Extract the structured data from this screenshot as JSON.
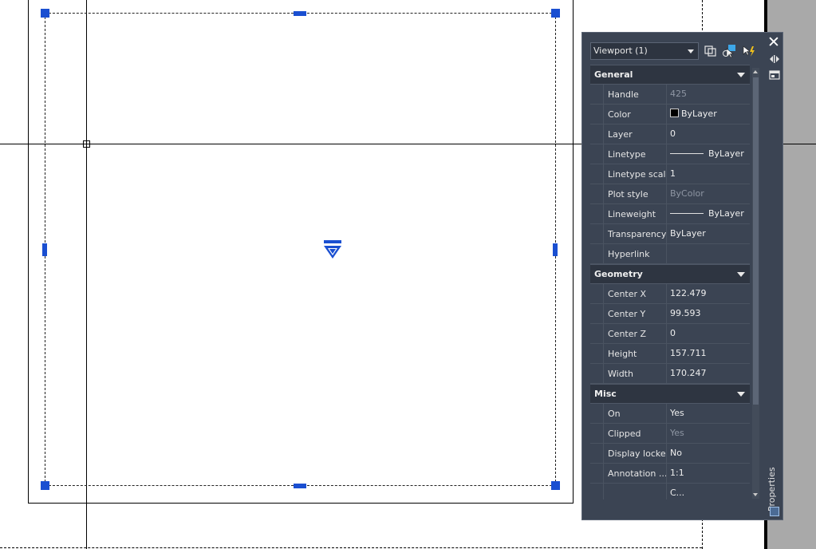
{
  "palette": {
    "object_type": "Viewport (1)",
    "vertical_title": "Properties",
    "sections": [
      {
        "title": "General",
        "rows": [
          {
            "name": "Handle",
            "value": "425",
            "dim": true
          },
          {
            "name": "Color",
            "value": "ByLayer",
            "kind": "color"
          },
          {
            "name": "Layer",
            "value": "0"
          },
          {
            "name": "Linetype",
            "value": "ByLayer",
            "kind": "line"
          },
          {
            "name": "Linetype scale",
            "value": "1"
          },
          {
            "name": "Plot style",
            "value": "ByColor",
            "dim": true
          },
          {
            "name": "Lineweight",
            "value": "ByLayer",
            "kind": "line"
          },
          {
            "name": "Transparency",
            "value": "ByLayer"
          },
          {
            "name": "Hyperlink",
            "value": ""
          }
        ]
      },
      {
        "title": "Geometry",
        "rows": [
          {
            "name": "Center X",
            "value": "122.479"
          },
          {
            "name": "Center Y",
            "value": "99.593"
          },
          {
            "name": "Center Z",
            "value": "0"
          },
          {
            "name": "Height",
            "value": "157.711"
          },
          {
            "name": "Width",
            "value": "170.247"
          }
        ]
      },
      {
        "title": "Misc",
        "rows": [
          {
            "name": "On",
            "value": "Yes"
          },
          {
            "name": "Clipped",
            "value": "Yes",
            "dim": true
          },
          {
            "name": "Display locked",
            "value": "No"
          },
          {
            "name": "Annotation ...",
            "value": "1:1"
          },
          {
            "name": "",
            "value": "C..."
          }
        ]
      }
    ]
  },
  "colors": {
    "grip": "#1a4fd1",
    "palette_bg": "#3b4453",
    "section_bg": "#2e3541"
  },
  "icons": {
    "toolbar": [
      "toggle-pickadd-icon",
      "select-objects-icon",
      "quick-select-icon"
    ],
    "side": [
      "close-icon",
      "auto-hide-icon",
      "properties-menu-icon",
      "properties-icon"
    ],
    "canvas": [
      "viewport-arrow-icon"
    ]
  }
}
